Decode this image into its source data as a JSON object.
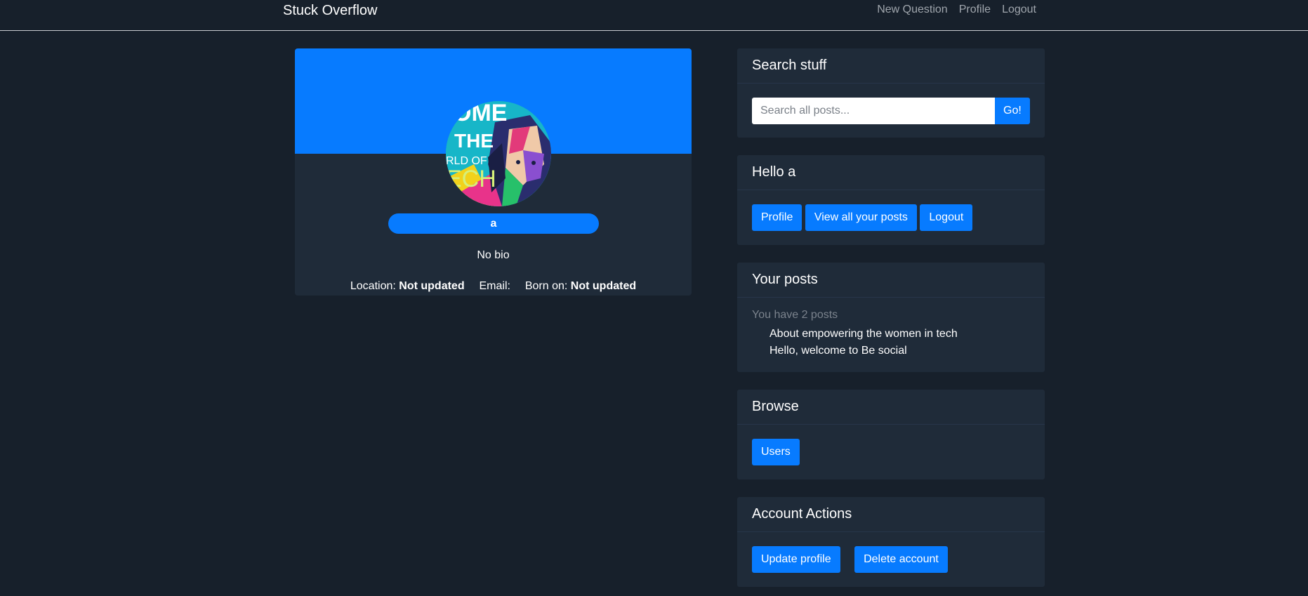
{
  "navbar": {
    "brand": "Stuck Overflow",
    "links": [
      "New Question",
      "Profile",
      "Logout"
    ]
  },
  "profile": {
    "username": "a",
    "bio": "No bio",
    "location_label": "Location:",
    "location_value": "Not updated",
    "email_label": "Email:",
    "email_value": "",
    "born_label": "Born on:",
    "born_value": "Not updated",
    "avatar_text": [
      "OME",
      "THE",
      "RLD OF",
      "ECH"
    ]
  },
  "search": {
    "title": "Search stuff",
    "placeholder": "Search all posts...",
    "button": "Go!"
  },
  "hello": {
    "title": "Hello a",
    "buttons": [
      "Profile",
      "View all your posts",
      "Logout"
    ]
  },
  "your_posts": {
    "title": "Your posts",
    "count_text": "You have 2 posts",
    "posts": [
      "About empowering the women in tech",
      "Hello, welcome to Be social"
    ]
  },
  "browse": {
    "title": "Browse",
    "button": "Users"
  },
  "account": {
    "title": "Account Actions",
    "update_button": "Update profile",
    "delete_button": "Delete account"
  },
  "colors": {
    "background": "#17202b",
    "card": "#1f2b39",
    "accent": "#077bff"
  }
}
